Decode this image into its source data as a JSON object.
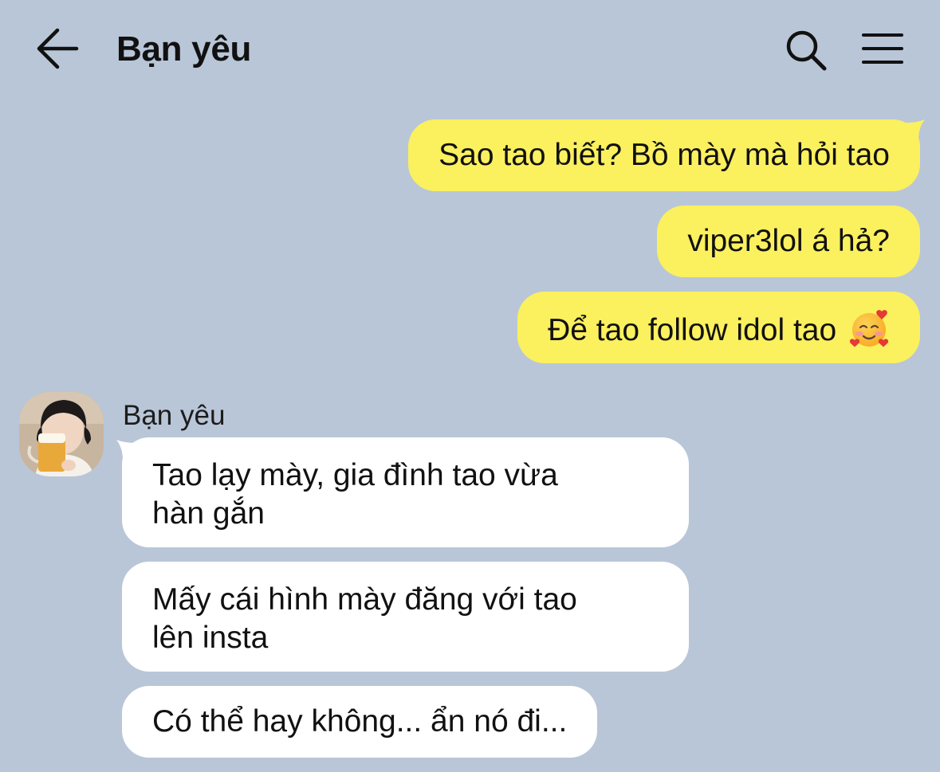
{
  "header": {
    "back_icon": "arrow-left-icon",
    "title": "Bạn yêu",
    "search_icon": "search-icon",
    "menu_icon": "hamburger-menu-icon"
  },
  "colors": {
    "background": "#b9c6d8",
    "outgoing_bubble": "#fbf05e",
    "incoming_bubble": "#ffffff"
  },
  "outgoing_messages": [
    {
      "text": "Sao tao biết? Bồ mày mà hỏi tao"
    },
    {
      "text": "viper3lol á hả?"
    },
    {
      "text": "Để tao follow idol tao",
      "emoji": "smiling-face-with-hearts"
    }
  ],
  "incoming": {
    "sender_name": "Bạn yêu",
    "avatar": "profile-photo",
    "messages": [
      {
        "lines": [
          "Tao lạy mày, gia đình tao vừa",
          "hàn gắn"
        ]
      },
      {
        "lines": [
          "Mấy cái hình mày đăng với tao",
          "lên insta"
        ]
      },
      {
        "lines": [
          "Có thể hay không... ẩn nó đi..."
        ]
      }
    ]
  }
}
